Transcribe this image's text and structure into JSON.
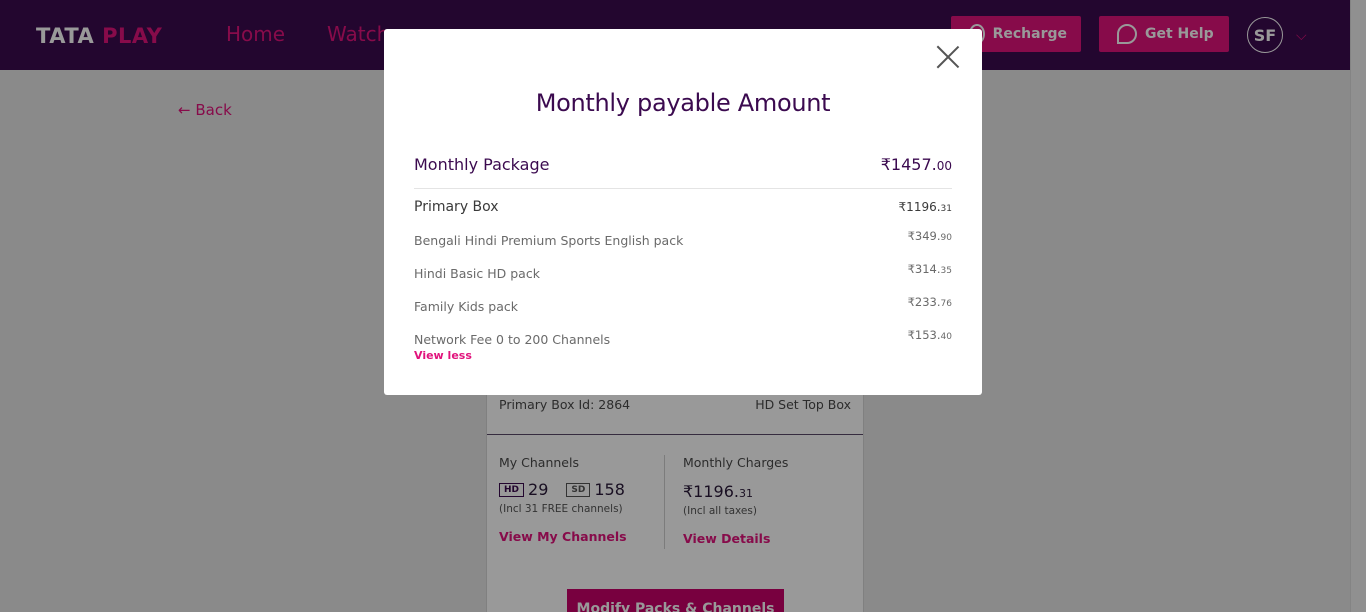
{
  "header": {
    "logo_part1": "TATA",
    "logo_part2": "PLAY",
    "nav": [
      "Home",
      "Watch"
    ],
    "recharge_label": "Recharge",
    "help_label": "Get Help",
    "avatar_initials": "SF",
    "colors": {
      "bar": "#3b0a4f",
      "accent": "#e1137c"
    }
  },
  "back_label": "Back",
  "card": {
    "box_id": "Primary Box Id: 2864",
    "box_type": "HD Set Top Box",
    "channels_label": "My Channels",
    "hd_badge": "HD",
    "hd_count": "29",
    "sd_badge": "SD",
    "sd_count": "158",
    "free_note": "(Incl 31 FREE channels)",
    "view_channels": "View My Channels",
    "charges_label": "Monthly Charges",
    "charges_int": "₹1196.",
    "charges_dec": "31",
    "tax_note": "(Incl all taxes)",
    "view_details": "View Details",
    "modify_button": "Modify Packs & Channels"
  },
  "modal": {
    "title": "Monthly payable Amount",
    "package_label": "Monthly Package",
    "package_int": "₹1457.",
    "package_dec": "00",
    "primary_label": "Primary Box",
    "primary_int": "₹1196.",
    "primary_dec": "31",
    "items": [
      {
        "name": "Bengali Hindi Premium Sports English pack",
        "int": "₹349.",
        "dec": "90"
      },
      {
        "name": "Hindi Basic HD pack",
        "int": "₹314.",
        "dec": "35"
      },
      {
        "name": "Family Kids pack",
        "int": "₹233.",
        "dec": "76"
      },
      {
        "name": "Network Fee 0 to 200 Channels",
        "int": "₹153.",
        "dec": "40"
      }
    ],
    "view_less": "View less"
  }
}
